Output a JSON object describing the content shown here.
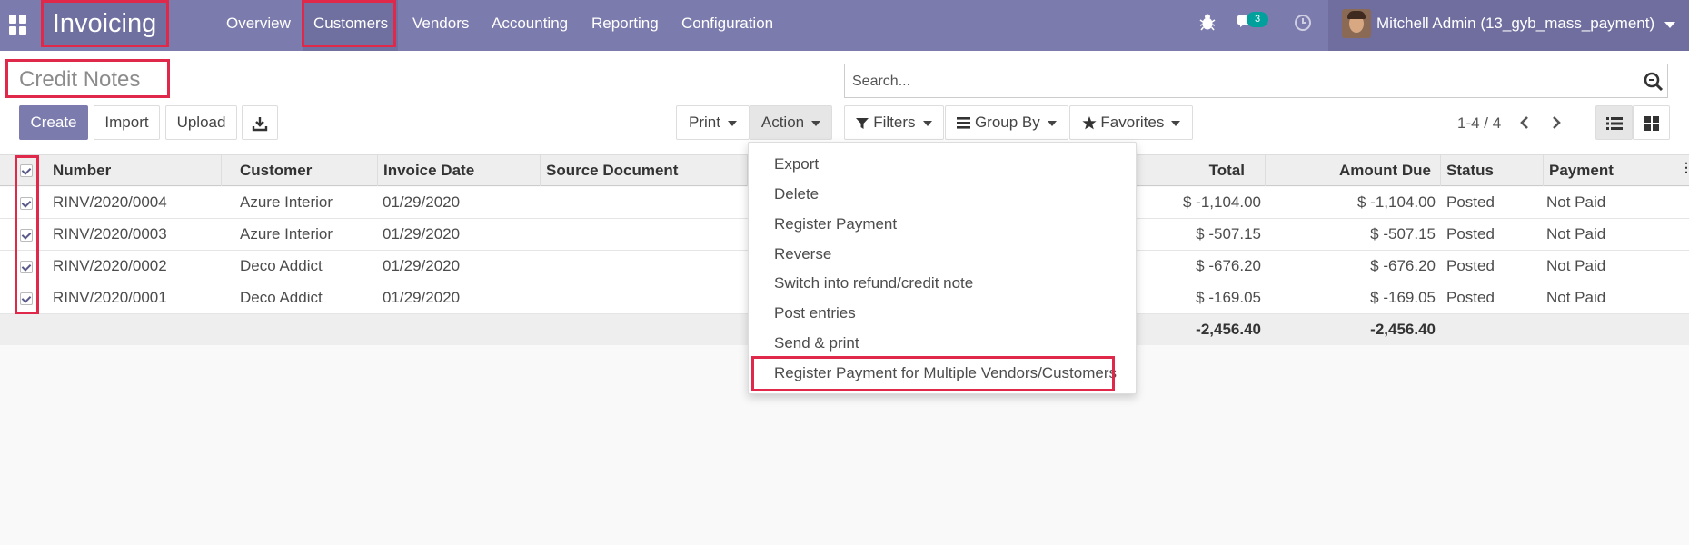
{
  "navbar": {
    "brand": "Invoicing",
    "menu": [
      "Overview",
      "Customers",
      "Vendors",
      "Accounting",
      "Reporting",
      "Configuration"
    ],
    "messages_count": "3",
    "user": "Mitchell Admin (13_gyb_mass_payment)",
    "icons": [
      "apps-grid-icon",
      "bug-icon",
      "chat-icon",
      "clock-icon",
      "avatar",
      "chevron-down-icon"
    ]
  },
  "control_panel": {
    "title": "Credit Notes",
    "search_placeholder": "Search...",
    "buttons": {
      "create": "Create",
      "import": "Import",
      "upload": "Upload"
    },
    "print": "Print",
    "action": "Action",
    "filters": "Filters",
    "group_by": "Group By",
    "favorites": "Favorites",
    "pager": "1-4 / 4"
  },
  "table": {
    "headers": [
      "Number",
      "Customer",
      "Invoice Date",
      "Source Document",
      "Total",
      "Amount Due",
      "Status",
      "Payment"
    ],
    "rows": [
      {
        "number": "RINV/2020/0004",
        "customer": "Azure Interior",
        "date": "01/29/2020",
        "total": "$ -1,104.00",
        "due": "$ -1,104.00",
        "status": "Posted",
        "payment": "Not Paid"
      },
      {
        "number": "RINV/2020/0003",
        "customer": "Azure Interior",
        "date": "01/29/2020",
        "total": "$ -507.15",
        "due": "$ -507.15",
        "status": "Posted",
        "payment": "Not Paid"
      },
      {
        "number": "RINV/2020/0002",
        "customer": "Deco Addict",
        "date": "01/29/2020",
        "total": "$ -676.20",
        "due": "$ -676.20",
        "status": "Posted",
        "payment": "Not Paid"
      },
      {
        "number": "RINV/2020/0001",
        "customer": "Deco Addict",
        "date": "01/29/2020",
        "total": "$ -169.05",
        "due": "$ -169.05",
        "status": "Posted",
        "payment": "Not Paid"
      }
    ],
    "footer": {
      "total": "-2,456.40",
      "due": "-2,456.40"
    }
  },
  "action_menu": [
    "Export",
    "Delete",
    "Register Payment",
    "Reverse",
    "Switch into refund/credit note",
    "Post entries",
    "Send & print",
    "Register Payment for Multiple Vendors/Customers"
  ],
  "colors": {
    "brand": "#7c7bad",
    "highlight": "#e0294a",
    "badge": "#00a09d"
  }
}
